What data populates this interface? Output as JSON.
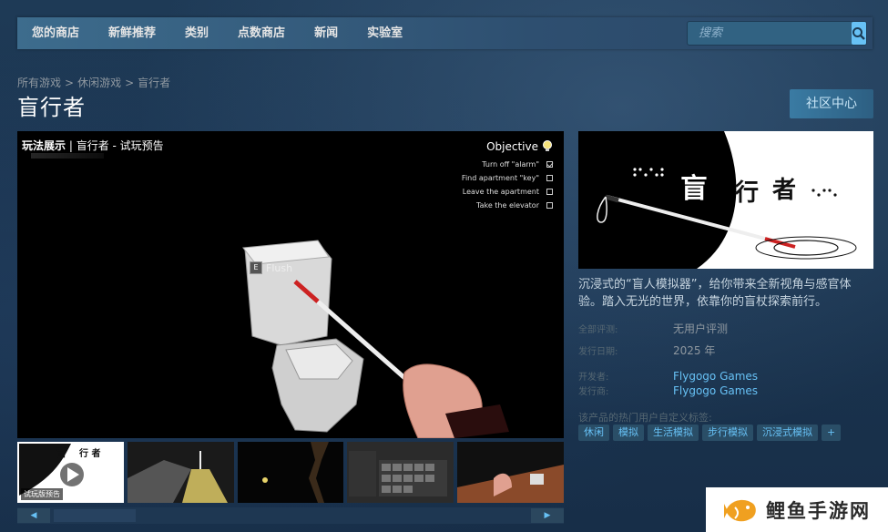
{
  "nav": {
    "items": [
      "您的商店",
      "新鲜推荐",
      "类别",
      "点数商店",
      "新闻",
      "实验室"
    ],
    "search_placeholder": "搜索"
  },
  "breadcrumb": [
    "所有游戏",
    "休闲游戏",
    "盲行者"
  ],
  "title": "盲行者",
  "community_button": "社区中心",
  "video": {
    "label_bold": "玩法展示",
    "label_rest": " | 盲行者 - 试玩预告",
    "objective_title": "Objective",
    "objectives": [
      {
        "text": "Turn off \"alarm\"",
        "done": true
      },
      {
        "text": "Find apartment \"key\"",
        "done": false
      },
      {
        "text": "Leave the apartment",
        "done": false
      },
      {
        "text": "Take the elevator",
        "done": false
      }
    ],
    "prompt_key": "E",
    "prompt_text": "Flush"
  },
  "thumbs": {
    "first_badge": "试玩版预告"
  },
  "capsule": {
    "title_chars": [
      "盲",
      "行",
      "者"
    ]
  },
  "description": "沉浸式的“盲人模拟器”，给你带来全新视角与感官体验。踏入无光的世界，依靠你的盲杖探索前行。",
  "info": {
    "review_label": "全部评测:",
    "review_value": "无用户评测",
    "date_label": "发行日期:",
    "date_value": "2025 年",
    "developer_label": "开发者:",
    "developer_value": "Flygogo Games",
    "publisher_label": "发行商:",
    "publisher_value": "Flygogo Games"
  },
  "tags_label": "该产品的热门用户自定义标签:",
  "tags": [
    "休闲",
    "模拟",
    "生活模拟",
    "步行模拟",
    "沉浸式模拟",
    "+"
  ],
  "watermark": "鲤鱼手游网",
  "colors": {
    "accent": "#67c1f5",
    "nav_bg": "#3d6c8d",
    "page_bg": "#1b3550"
  }
}
